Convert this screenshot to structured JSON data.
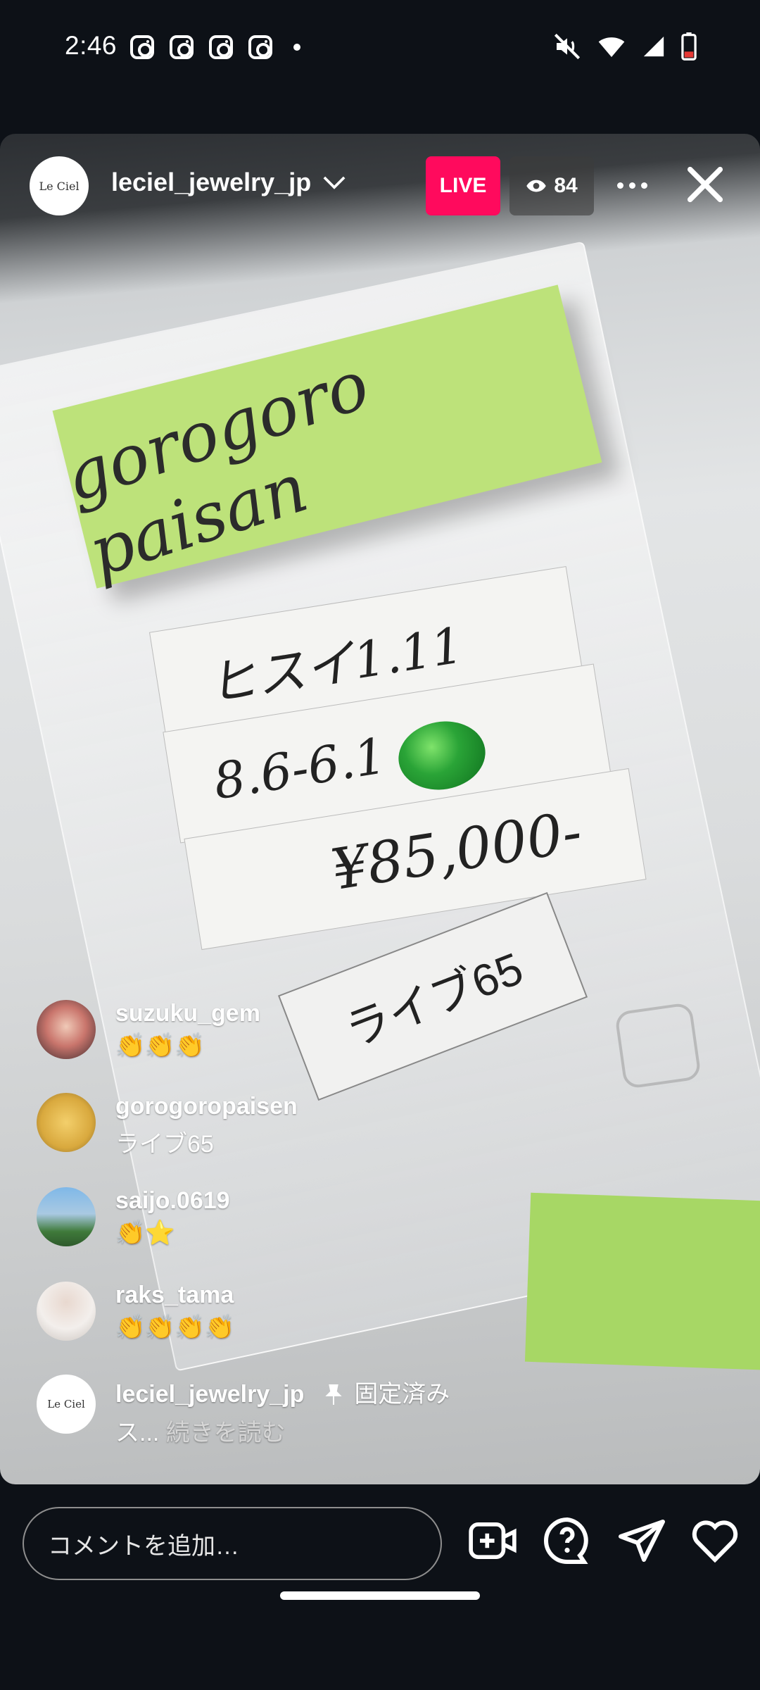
{
  "status_bar": {
    "time": "2:46"
  },
  "live_header": {
    "host_username": "leciel_jewelry_jp",
    "host_avatar_text": "Le Ciel",
    "live_label": "LIVE",
    "viewer_count": "84"
  },
  "video_content": {
    "sticky_note": "gorogoro paisan",
    "label_line1": "ヒスイ1.11",
    "label_line2": "8.6-6.1",
    "label_line3": "¥85,000-",
    "tag_text": "ライブ65"
  },
  "comments": [
    {
      "user": "suzuku_gem",
      "text": "👏👏👏"
    },
    {
      "user": "gorogoropaisen",
      "text": "ライブ65"
    },
    {
      "user": "saijo.0619",
      "text": "👏⭐"
    },
    {
      "user": "raks_tama",
      "text": "👏👏👏👏"
    },
    {
      "user": "leciel_jewelry_jp",
      "pinned_label": "固定済み",
      "text": "ス...",
      "read_more": "続きを読む",
      "avatar_text": "Le Ciel"
    }
  ],
  "bottom_bar": {
    "comment_placeholder": "コメントを追加…"
  }
}
